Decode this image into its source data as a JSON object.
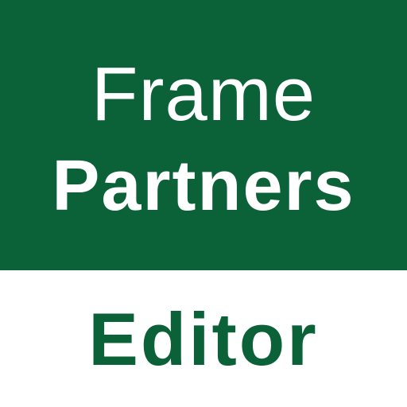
{
  "logo": {
    "line1": "Frame",
    "line2": "Partners",
    "line3": "Editor"
  },
  "colors": {
    "brand_green": "#0b6238",
    "background": "#ffffff",
    "text_on_green": "#ffffff"
  }
}
